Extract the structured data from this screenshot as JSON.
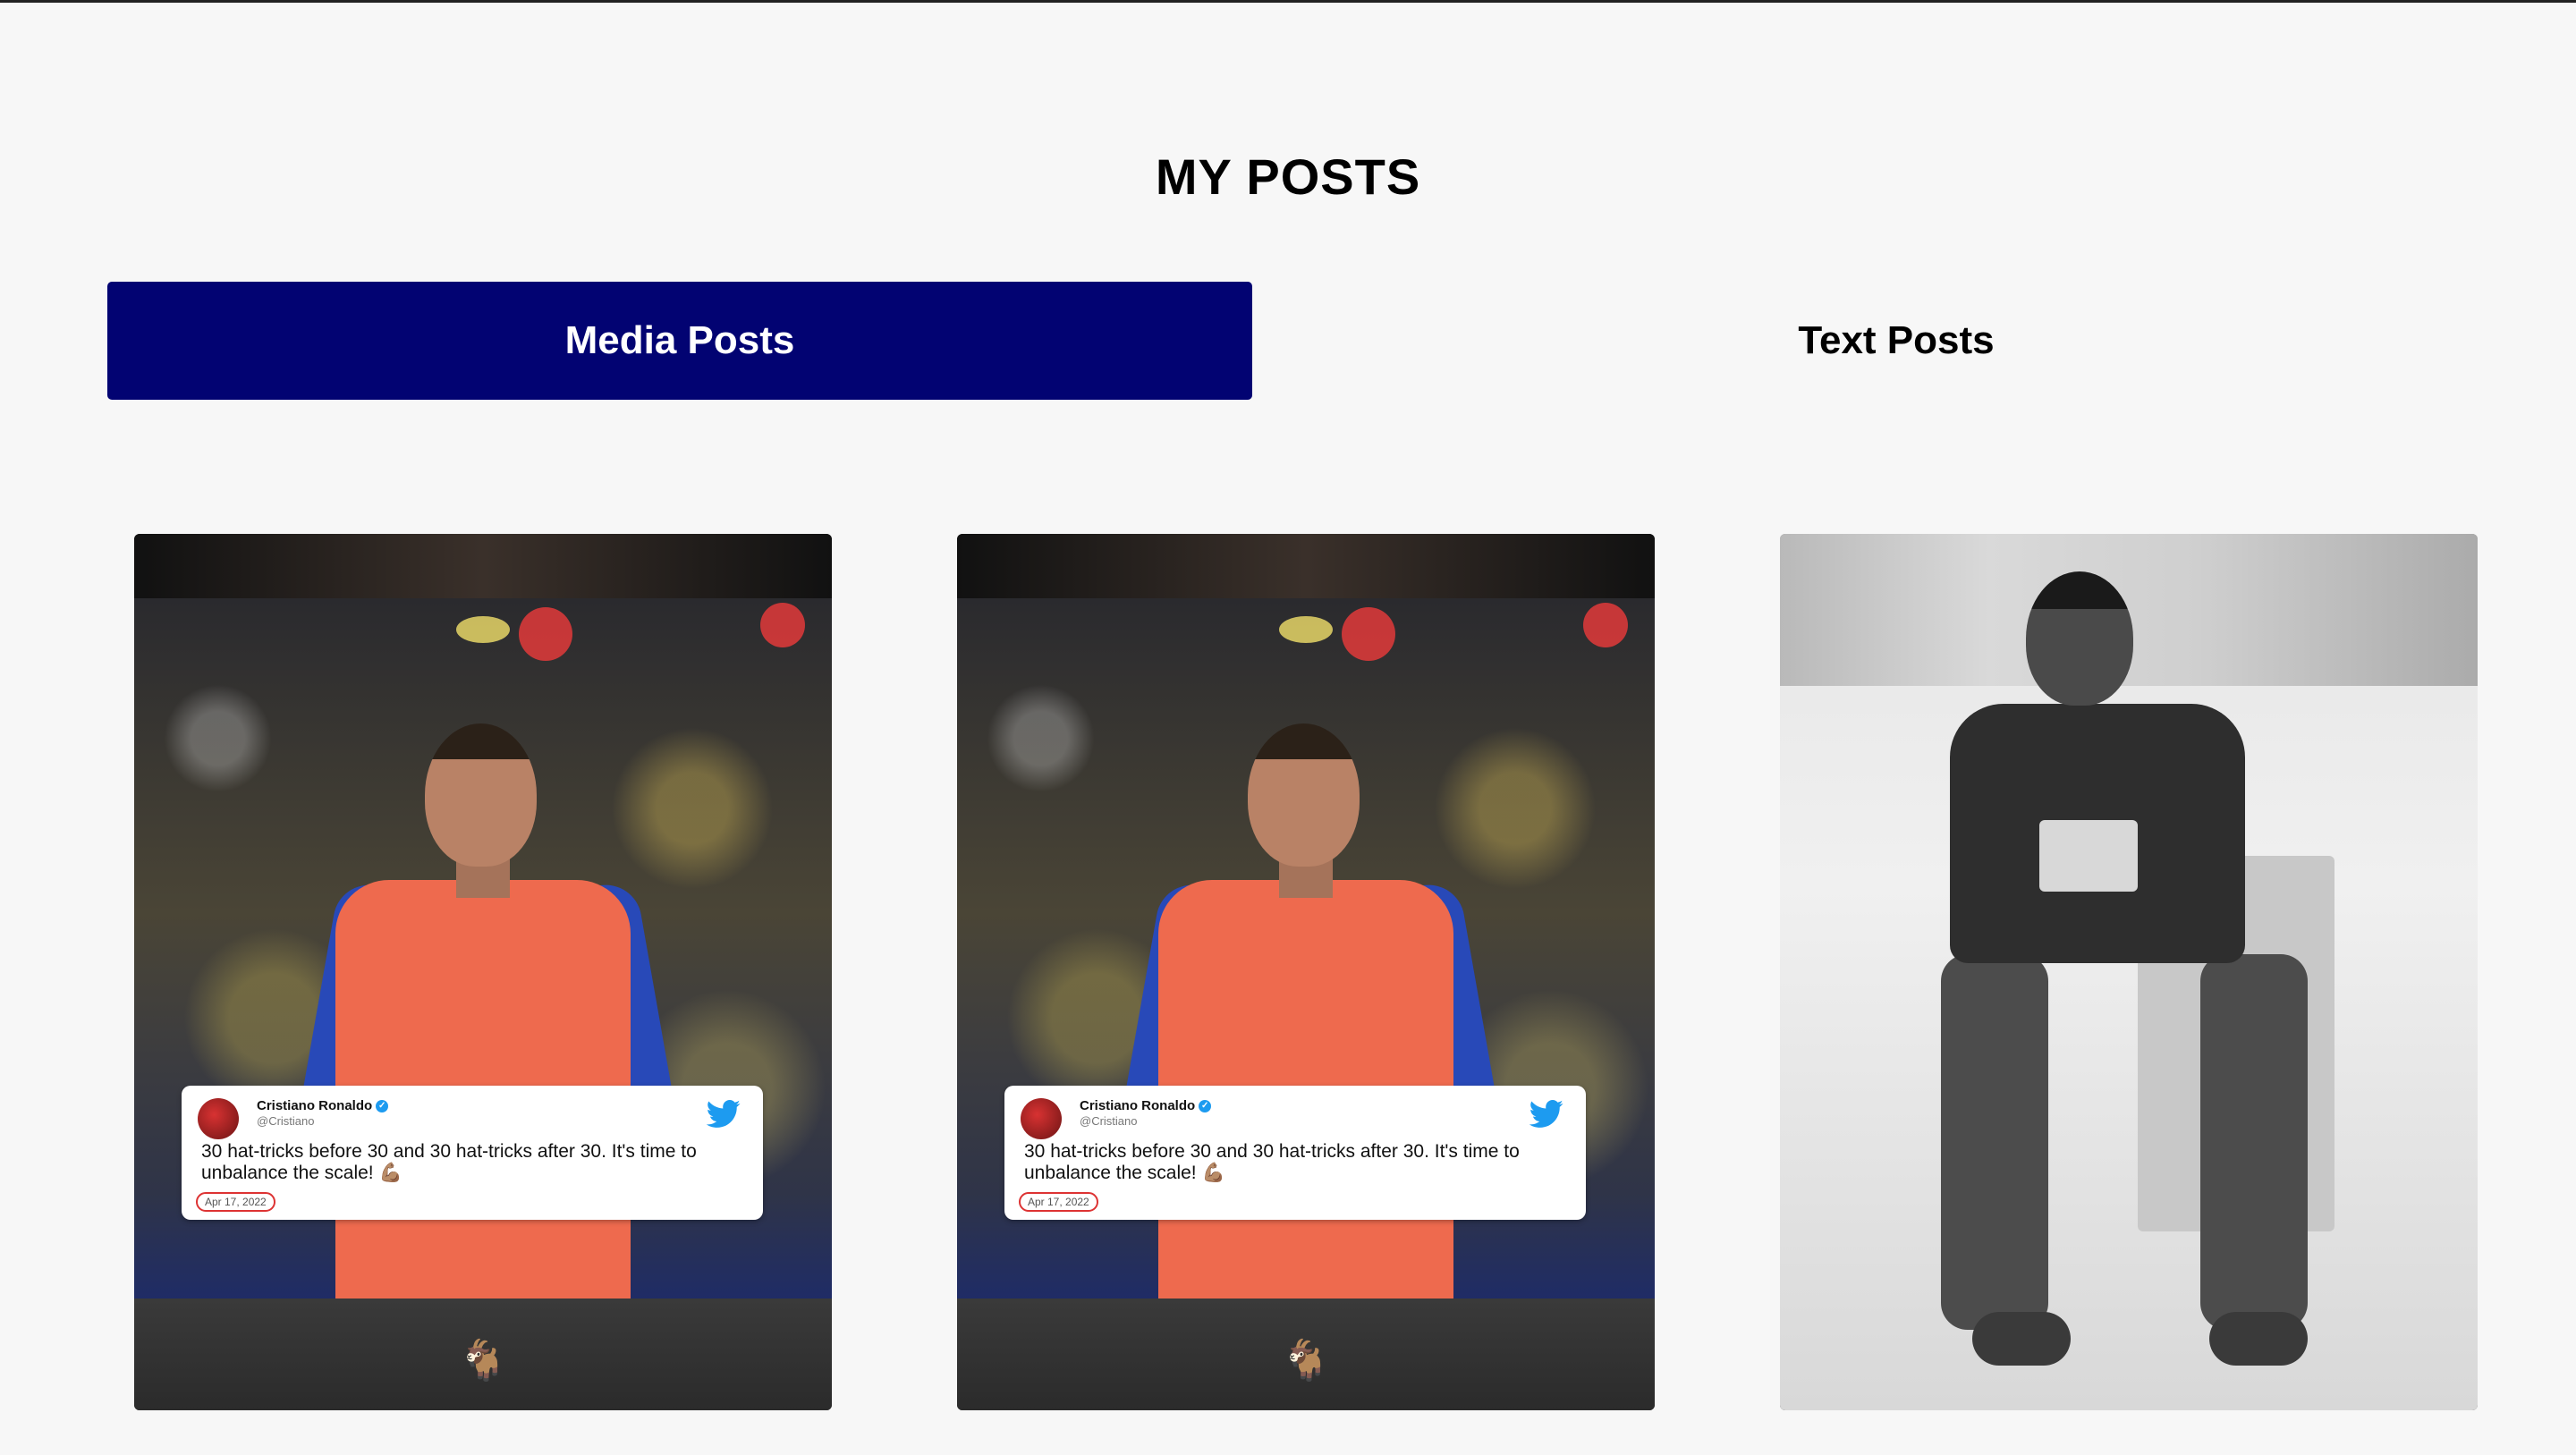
{
  "page": {
    "title": "MY POSTS"
  },
  "tabs": [
    {
      "label": "Media Posts",
      "active": true
    },
    {
      "label": "Text Posts",
      "active": false
    }
  ],
  "colors": {
    "active_tab_bg": "#020372",
    "page_bg": "#f7f7f7"
  },
  "posts": [
    {
      "type": "image",
      "tweet": {
        "name": "Cristiano Ronaldo",
        "handle": "@Cristiano",
        "text": "30 hat-tricks before 30 and 30 hat-tricks after 30. It's time to unbalance the scale! 💪🏽",
        "date": "Apr 17, 2022"
      },
      "caption_icon": "goat-icon",
      "caption_emoji": "🐐"
    },
    {
      "type": "image",
      "tweet": {
        "name": "Cristiano Ronaldo",
        "handle": "@Cristiano",
        "text": "30 hat-tricks before 30 and 30 hat-tricks after 30. It's time to unbalance the scale! 💪🏽",
        "date": "Apr 17, 2022"
      },
      "caption_icon": "goat-icon",
      "caption_emoji": "🐐"
    },
    {
      "type": "image",
      "style": "grayscale portrait"
    }
  ]
}
